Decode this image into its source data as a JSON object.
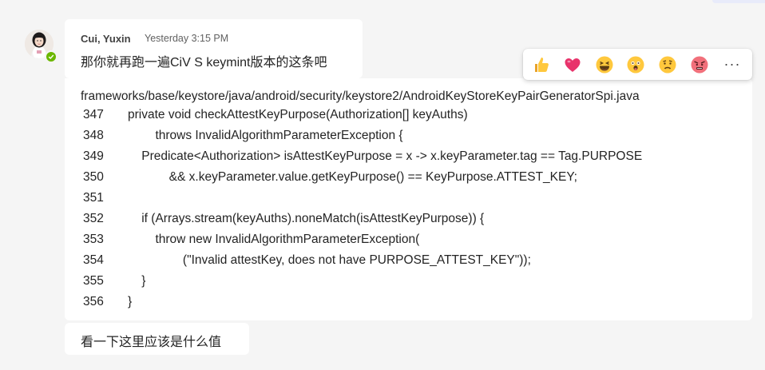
{
  "message1": {
    "author": "Cui, Yuxin",
    "timestamp": "Yesterday 3:15 PM",
    "text": "那你就再跑一遍CiV S keymint版本的这条吧"
  },
  "message2": {
    "path": "frameworks/base/keystore/java/android/security/keystore2/AndroidKeyStoreKeyPairGeneratorSpi.java",
    "lines": [
      {
        "num": "347",
        "code": "private void checkAttestKeyPurpose(Authorization[] keyAuths)"
      },
      {
        "num": "348",
        "code": "        throws InvalidAlgorithmParameterException {"
      },
      {
        "num": "349",
        "code": "    Predicate<Authorization> isAttestKeyPurpose = x -> x.keyParameter.tag == Tag.PURPOSE"
      },
      {
        "num": "350",
        "code": "            && x.keyParameter.value.getKeyPurpose() == KeyPurpose.ATTEST_KEY;"
      },
      {
        "num": "351",
        "code": ""
      },
      {
        "num": "352",
        "code": "    if (Arrays.stream(keyAuths).noneMatch(isAttestKeyPurpose)) {"
      },
      {
        "num": "353",
        "code": "        throw new InvalidAlgorithmParameterException("
      },
      {
        "num": "354",
        "code": "                (\"Invalid attestKey, does not have PURPOSE_ATTEST_KEY\"));"
      },
      {
        "num": "355",
        "code": "    }"
      },
      {
        "num": "356",
        "code": "}"
      }
    ]
  },
  "message3": {
    "text": "看一下这里应该是什么值"
  },
  "reactions": {
    "items": [
      "like-icon",
      "heart-icon",
      "laugh-icon",
      "surprised-icon",
      "sad-icon",
      "angry-icon"
    ],
    "more_label": "···"
  },
  "presence": {
    "status": "available",
    "color": "#6bb700"
  }
}
